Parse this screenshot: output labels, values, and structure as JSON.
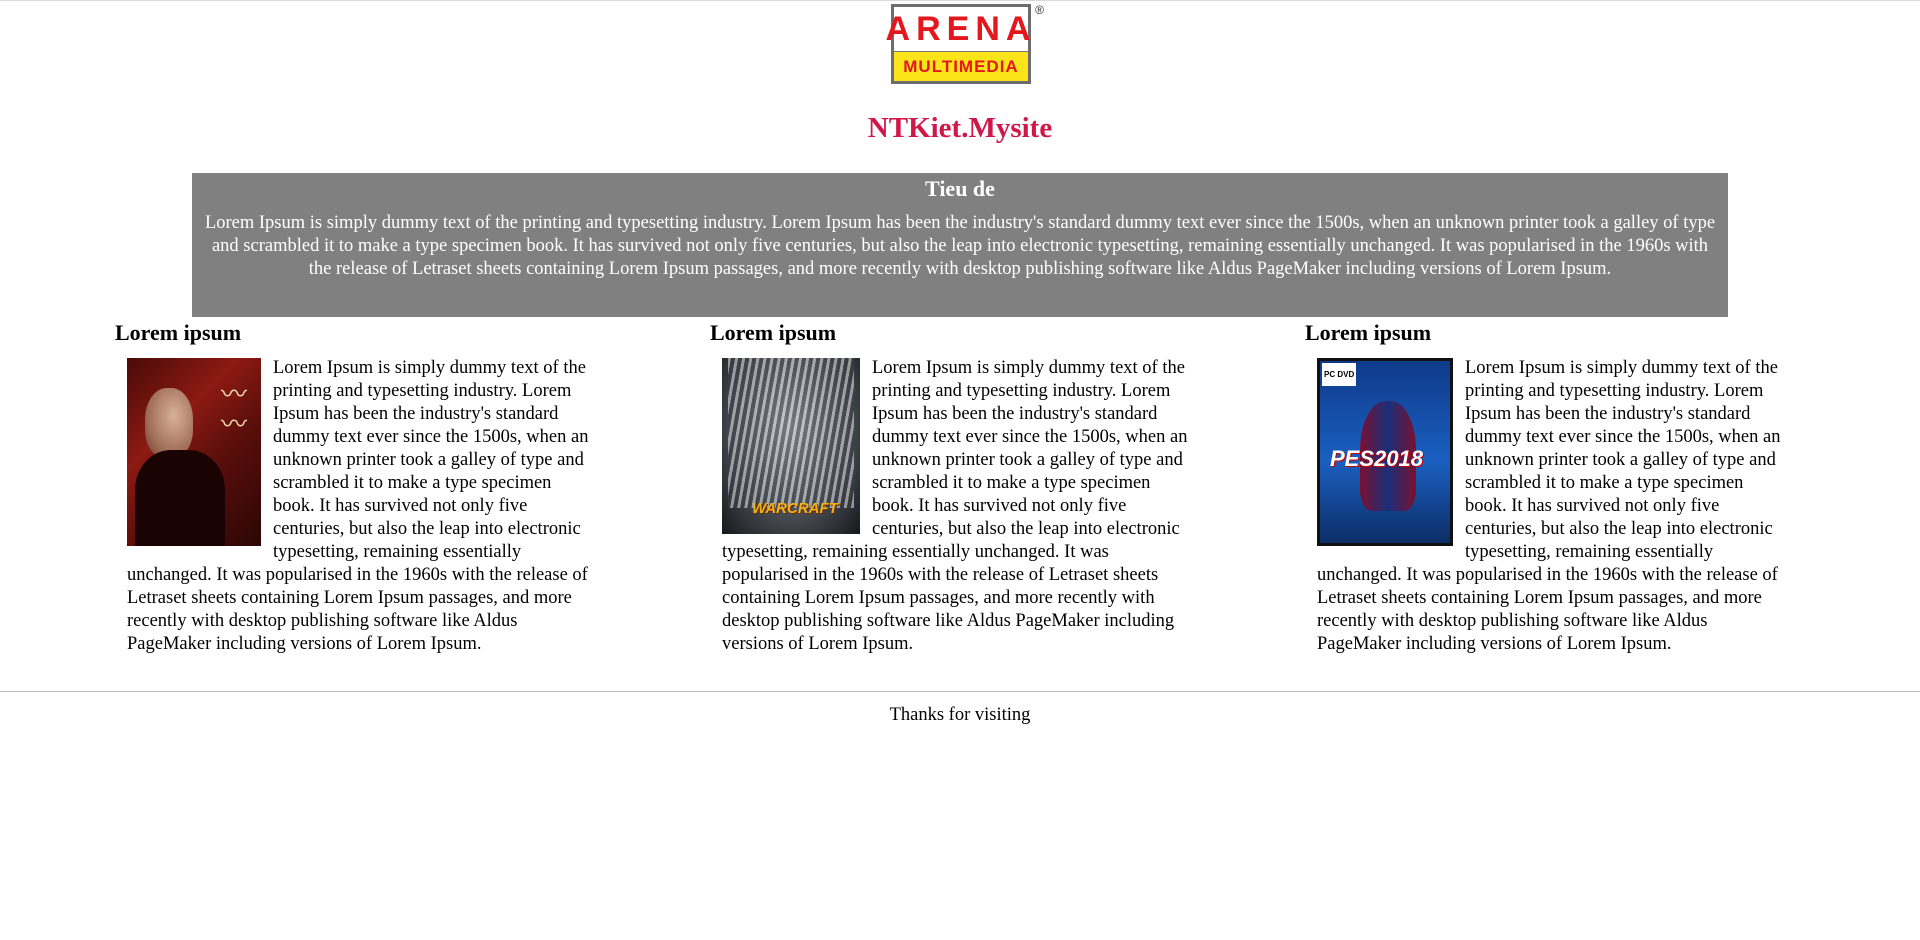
{
  "logo": {
    "top_text": "ARENA",
    "bottom_text": "MULTIMEDIA",
    "registered_mark": "®"
  },
  "site_title": "NTKiet.Mysite",
  "banner": {
    "heading": "Tieu de",
    "text": "Lorem Ipsum is simply dummy text of the printing and typesetting industry. Lorem Ipsum has been the industry's standard dummy text ever since the 1500s, when an unknown printer took a galley of type and scrambled it to make a type specimen book. It has survived not only five centuries, but also the leap into electronic typesetting, remaining essentially unchanged. It was popularised in the 1960s with the release of Letraset sheets containing Lorem Ipsum passages, and more recently with desktop publishing software like Aldus PageMaker including versions of Lorem Ipsum."
  },
  "columns": [
    {
      "heading": "Lorem ipsum",
      "text": "Lorem Ipsum is simply dummy text of the printing and typesetting industry. Lorem Ipsum has been the industry's standard dummy text ever since the 1500s, when an unknown printer took a galley of type and scrambled it to make a type specimen book. It has survived not only five centuries, but also the leap into electronic typesetting, remaining essentially unchanged. It was popularised in the 1960s with the release of Letraset sheets containing Lorem Ipsum passages, and more recently with desktop publishing software like Aldus PageMaker including versions of Lorem Ipsum.",
      "image": "movie-poster-image"
    },
    {
      "heading": "Lorem ipsum",
      "text": "Lorem Ipsum is simply dummy text of the printing and typesetting industry. Lorem Ipsum has been the industry's standard dummy text ever since the 1500s, when an unknown printer took a galley of type and scrambled it to make a type specimen book. It has survived not only five centuries, but also the leap into electronic typesetting, remaining essentially unchanged. It was popularised in the 1960s with the release of Letraset sheets containing Lorem Ipsum passages, and more recently with desktop publishing software like Aldus PageMaker including versions of Lorem Ipsum.",
      "image": "warcraft-cover-image",
      "image_text": "WARCRAFT"
    },
    {
      "heading": "Lorem ipsum",
      "text": "Lorem Ipsum is simply dummy text of the printing and typesetting industry. Lorem Ipsum has been the industry's standard dummy text ever since the 1500s, when an unknown printer took a galley of type and scrambled it to make a type specimen book. It has survived not only five centuries, but also the leap into electronic typesetting, remaining essentially unchanged. It was popularised in the 1960s with the release of Letraset sheets containing Lorem Ipsum passages, and more recently with desktop publishing software like Aldus PageMaker including versions of Lorem Ipsum.",
      "image": "pes-2018-cover-image",
      "image_text": "PES2018",
      "image_badge": "PC DVD"
    }
  ],
  "footer": {
    "text": "Thanks for visiting"
  },
  "colors": {
    "title": "#d0174a",
    "banner_bg": "#808080",
    "logo_red": "#e3171c",
    "logo_yellow": "#fbe51a"
  }
}
